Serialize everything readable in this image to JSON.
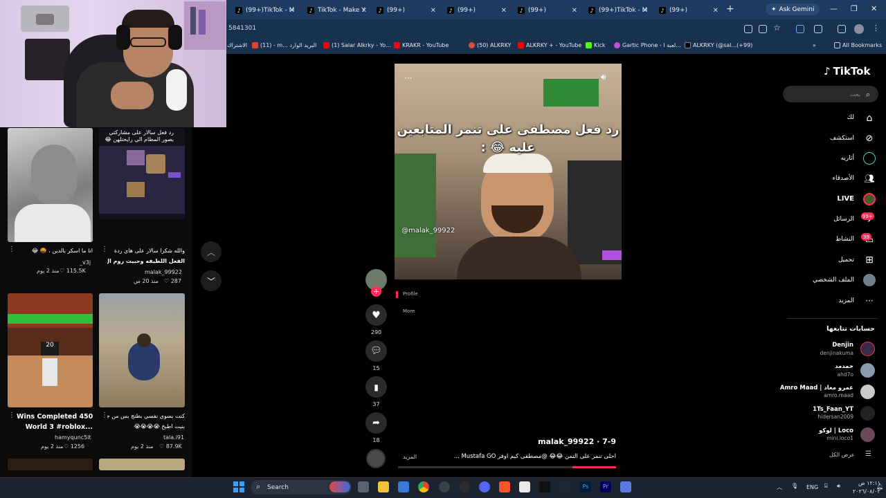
{
  "browser": {
    "tabs": [
      {
        "label": "(99+)TikTok - M"
      },
      {
        "label": "TikTok - Make Y"
      },
      {
        "label": "(99+)"
      },
      {
        "label": "(99+)"
      },
      {
        "label": "(99+)"
      },
      {
        "label": "(99+)TikTok - M"
      },
      {
        "label": "(99+)"
      }
    ],
    "new_tab": "+",
    "ask_gemini": "Ask Gemini",
    "url": "5841301",
    "bookmarks": [
      {
        "label": "الاشتراك"
      },
      {
        "label": "(11) - m... البريد الوارد"
      },
      {
        "label": "(1) Salar Alkrky - Yo..."
      },
      {
        "label": "KRAKR - YouTube"
      },
      {
        "label": "(50) ALKRKY"
      },
      {
        "label": "ALKRKY + - YouTube"
      },
      {
        "label": "Kick"
      },
      {
        "label": "Gartic Phone - لعبة ا..."
      },
      {
        "label": "ALKRKY (@sal...(+99)"
      }
    ],
    "all_bookmarks": "All Bookmarks"
  },
  "feed": {
    "items": [
      {
        "caption": [
          "",
          ""
        ],
        "meta_user": "_v3j",
        "likes": "115.5K",
        "time": "منذ 2 يوم",
        "title": "انا ما اسكر بالدين ، 🤬 😂"
      },
      {
        "caption": [
          "رد فعل سالار على مشاركتي",
          "بصور المطام الي رايحتلهن 😂"
        ],
        "meta_user": "malak_99922",
        "likes": "287",
        "time": "منذ 20 س",
        "title": "والله شكراً سالار على هاي ردة",
        "title2": "الفعل اللطيفه وحبيت روم ال...od"
      },
      {
        "caption": [
          "",
          ""
        ],
        "meta_user": "hamyqunc5it",
        "likes": "1256",
        "time": "منذ 2 يوم",
        "title": "Wins Completed 450",
        "title2": "World 3 #roblox..."
      },
      {
        "caption": [
          "",
          ""
        ],
        "meta_user": "tala.i91",
        "likes": "87.9K",
        "time": "منذ 2 يوم",
        "title": "كنت بسوي نفسي بطنج بس من جد",
        "title2": "بنيت اطبخ 😭😭😭😭"
      }
    ]
  },
  "video": {
    "caption": "رد فعل مصطفى على تنمر المتابعين عليه 😂 :",
    "handle": "@malak_99922",
    "menu_items": [
      "Profile",
      "More"
    ],
    "likes": "290",
    "comments": "15",
    "saves": "37",
    "shares": "18",
    "author": "malak_99922 · 7-9",
    "description": "احلى تنمر على التمن 😂😂 @مصطفى كيم اوفر Mustafa GO ...",
    "more_label": "المزيد",
    "progress": 0.2
  },
  "sidebar": {
    "logo": "TikTok",
    "search_placeholder": "بحث",
    "nav": [
      {
        "label": "لك"
      },
      {
        "label": "استكشف"
      },
      {
        "label": "أثاريه"
      },
      {
        "label": "الأصدقاء"
      },
      {
        "label": "LIVE"
      },
      {
        "label": "الرسائل",
        "badge": "99+"
      },
      {
        "label": "النشاط",
        "badge": "39"
      },
      {
        "label": "تحميل"
      },
      {
        "label": "الملف الشخصي"
      },
      {
        "label": "المزيد"
      }
    ],
    "following_title": "حسابات تتابعها",
    "following": [
      {
        "name": "Denjin",
        "user": "denjinakuma"
      },
      {
        "name": "حمدمد",
        "user": "ahd7o"
      },
      {
        "name": "Amro Maad | عمرو معاد",
        "user": "amro.maad"
      },
      {
        "name": "1Ts_Faan_YT",
        "user": "hidersan2009"
      },
      {
        "name": "لوكو | Loco",
        "user": "mini.loco1"
      }
    ],
    "see_all": "عرض الكل"
  },
  "taskbar": {
    "search": "Search",
    "lang": "ENG",
    "time": "١٢:١١ ص",
    "date": "٢٠٢٦/٠٨/٠٢"
  },
  "colors": {
    "accent": "#fe2c55",
    "chrome": "#1f3a5f"
  }
}
